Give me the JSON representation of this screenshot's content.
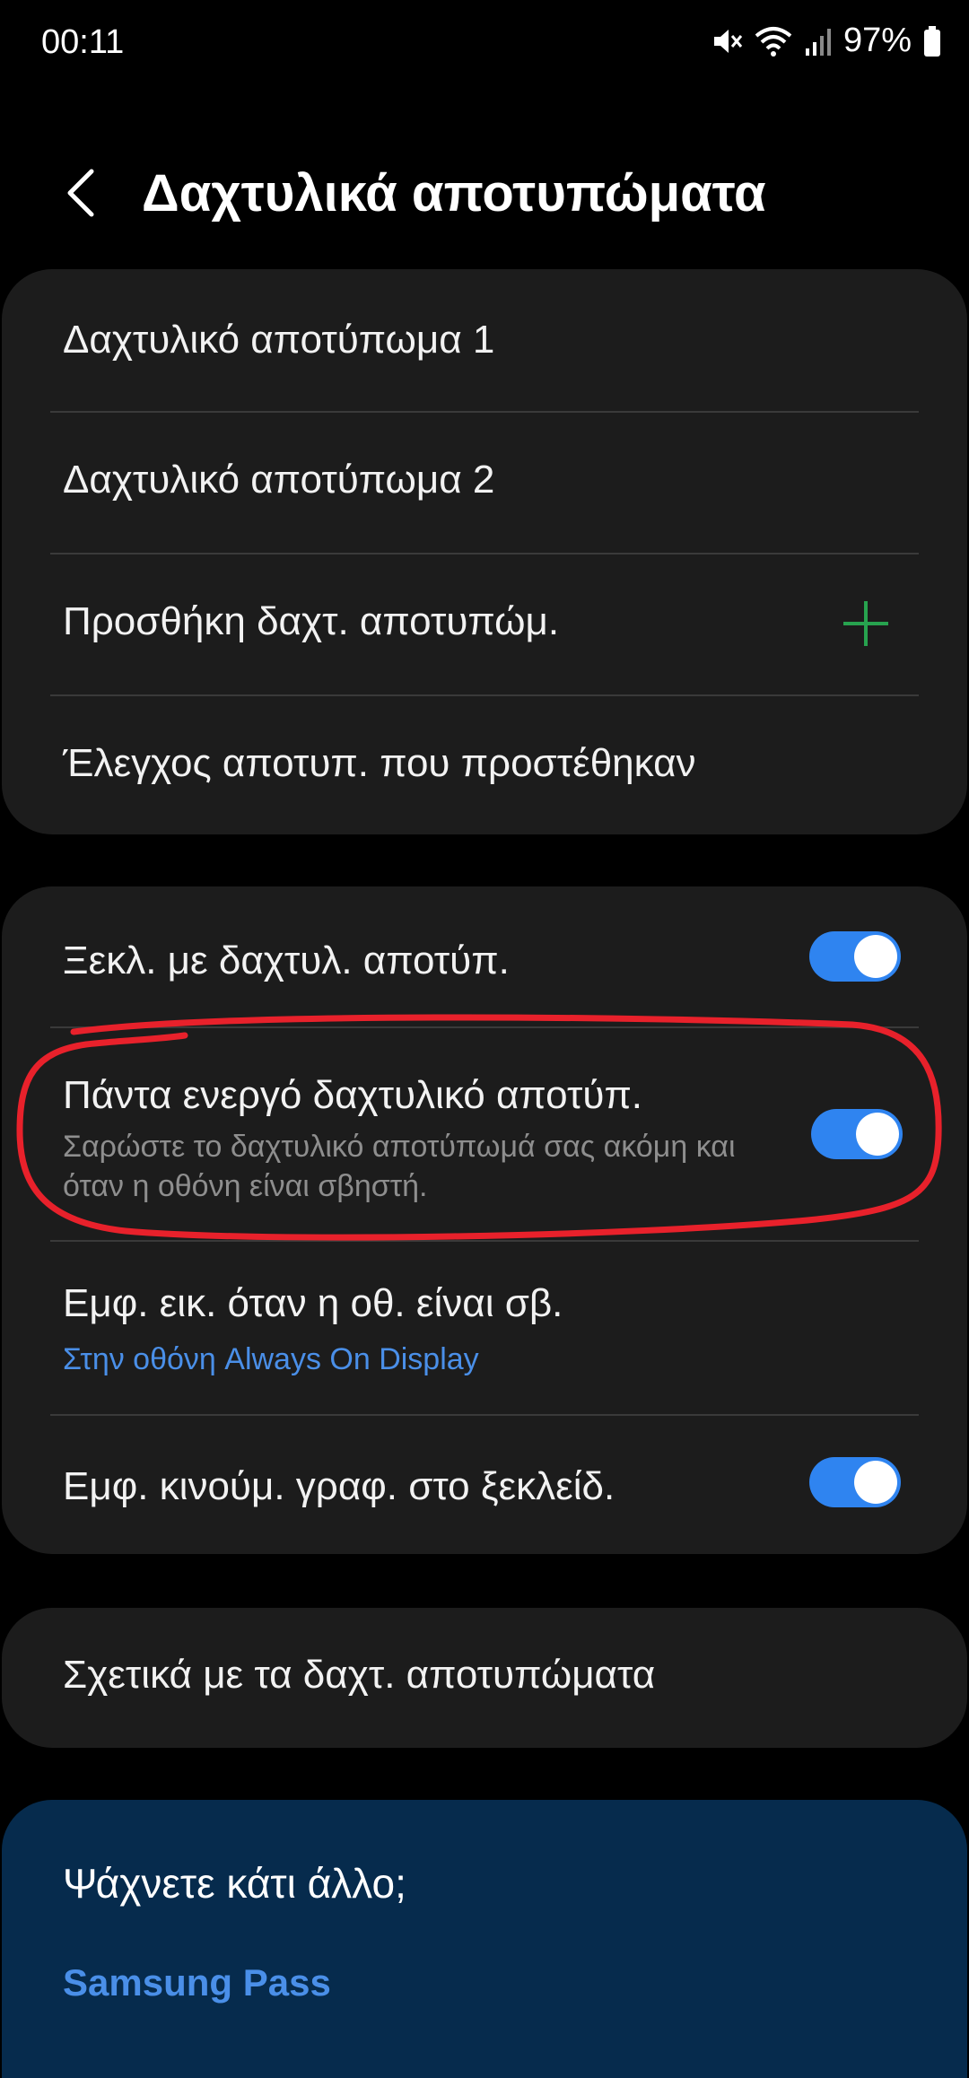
{
  "status_bar": {
    "time": "00:11",
    "battery": "97%",
    "icons": [
      "mute-icon",
      "wifi-icon",
      "signal-icon",
      "battery-icon"
    ]
  },
  "header": {
    "back_icon": "chevron-left-icon",
    "title": "Δαχτυλικά αποτυπώματα"
  },
  "fingerprints_card": {
    "items": [
      {
        "label": "Δαχτυλικό αποτύπωμα 1"
      },
      {
        "label": "Δαχτυλικό αποτύπωμα 2"
      },
      {
        "label": "Προσθήκη δαχτ. αποτυπώμ.",
        "icon": "plus-icon"
      },
      {
        "label": "Έλεγχος αποτυπ. που προστέθηκαν"
      }
    ]
  },
  "options_card": {
    "unlock": {
      "label": "Ξεκλ. με δαχτυλ. αποτύπ.",
      "on": true
    },
    "always_on": {
      "label": "Πάντα ενεργό δαχτυλικό αποτύπ.",
      "sub": "Σαρώστε το δαχτυλικό αποτύπωμά σας ακόμη και όταν η οθόνη είναι σβηστή.",
      "on": true
    },
    "show_icon": {
      "label": "Εμφ. εικ. όταν η οθ. είναι σβ.",
      "sub": "Στην οθόνη Always On Display"
    },
    "animation": {
      "label": "Εμφ. κινούμ. γραφ. στο ξεκλείδ.",
      "on": true
    }
  },
  "about_card": {
    "label": "Σχετικά με τα δαχτ. αποτυπώματα"
  },
  "help_card": {
    "title": "Ψάχνετε κάτι άλλο;",
    "link": "Samsung Pass"
  },
  "colors": {
    "accent": "#2f84f0",
    "link": "#4a8fe8",
    "annotation": "#e8212b",
    "plus": "#27a34f"
  }
}
